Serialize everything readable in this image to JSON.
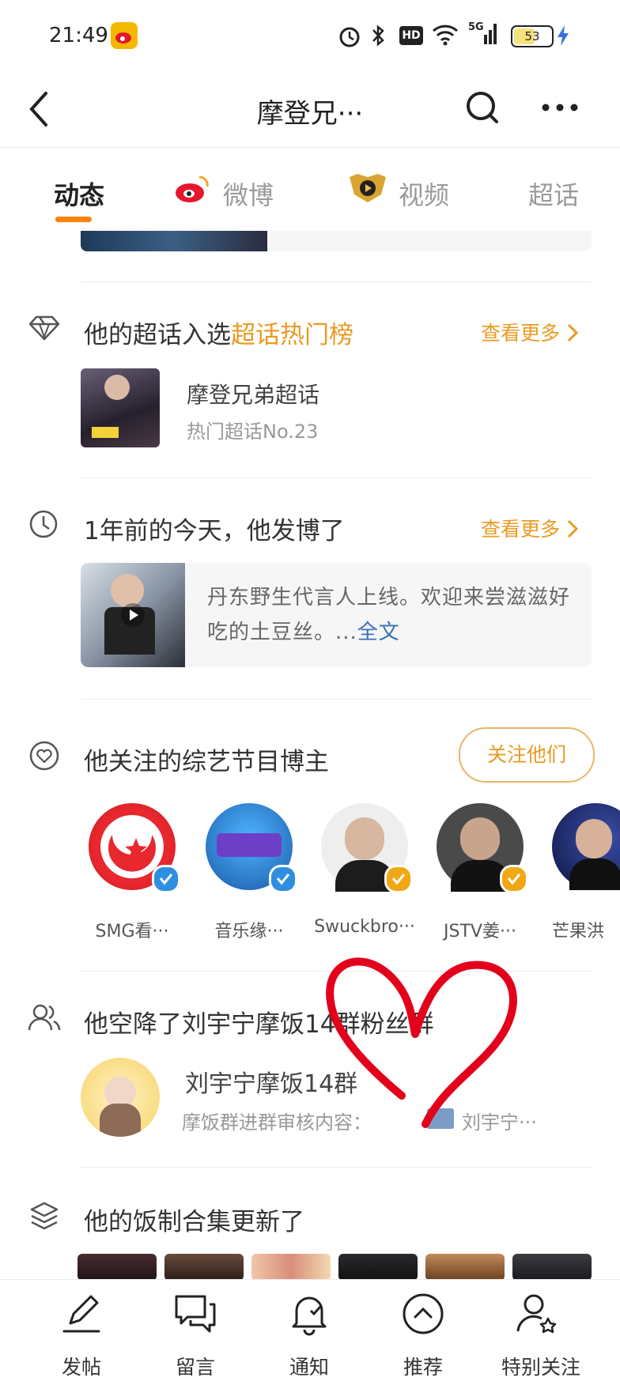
{
  "status_bar": {
    "time": "21:49",
    "battery": "53"
  },
  "nav": {
    "title": "摩登兄···"
  },
  "tabs": [
    {
      "label": "动态"
    },
    {
      "label": "微博"
    },
    {
      "label": "视频"
    },
    {
      "label": "超话"
    }
  ],
  "supertopic": {
    "title_prefix": "他的超话入选",
    "title_highlight": "超话热门榜",
    "more": "查看更多",
    "name": "摩登兄弟超话",
    "rank": "热门超话No.23"
  },
  "memory": {
    "title": "1年前的今天，他发博了",
    "more": "查看更多",
    "text": "丹东野生代言人上线。欢迎来尝滋滋好吃的土豆丝。...",
    "full_link": "全文"
  },
  "follows": {
    "title": "他关注的综艺节目博主",
    "button": "关注他们",
    "accounts": [
      {
        "name": "SMG看···",
        "badge_color": "#2e8fe0"
      },
      {
        "name": "音乐缘···",
        "badge_color": "#2e8fe0"
      },
      {
        "name": "Swuckbro···",
        "badge_color": "#f1a814"
      },
      {
        "name": "JSTV姜···",
        "badge_color": "#f1a814"
      },
      {
        "name": "芒果洪"
      }
    ]
  },
  "fan_group": {
    "title": "他空降了刘宇宁摩饭14群粉丝群",
    "name": "刘宇宁摩饭14群",
    "desc": "摩饭群进群审核内容：",
    "desc2": "刘宇宁···"
  },
  "collection": {
    "title": "他的饭制合集更新了"
  },
  "bottom_bar": [
    {
      "label": "发帖",
      "icon": "pen-icon"
    },
    {
      "label": "留言",
      "icon": "message-icon"
    },
    {
      "label": "通知",
      "icon": "bell-icon"
    },
    {
      "label": "推荐",
      "icon": "up-circle-icon"
    },
    {
      "label": "特别关注",
      "icon": "user-star-icon"
    }
  ],
  "colors": {
    "accent": "#ff8200",
    "highlight": "#e99a22",
    "link": "#3a6fb5",
    "heart": "#e3001b"
  }
}
